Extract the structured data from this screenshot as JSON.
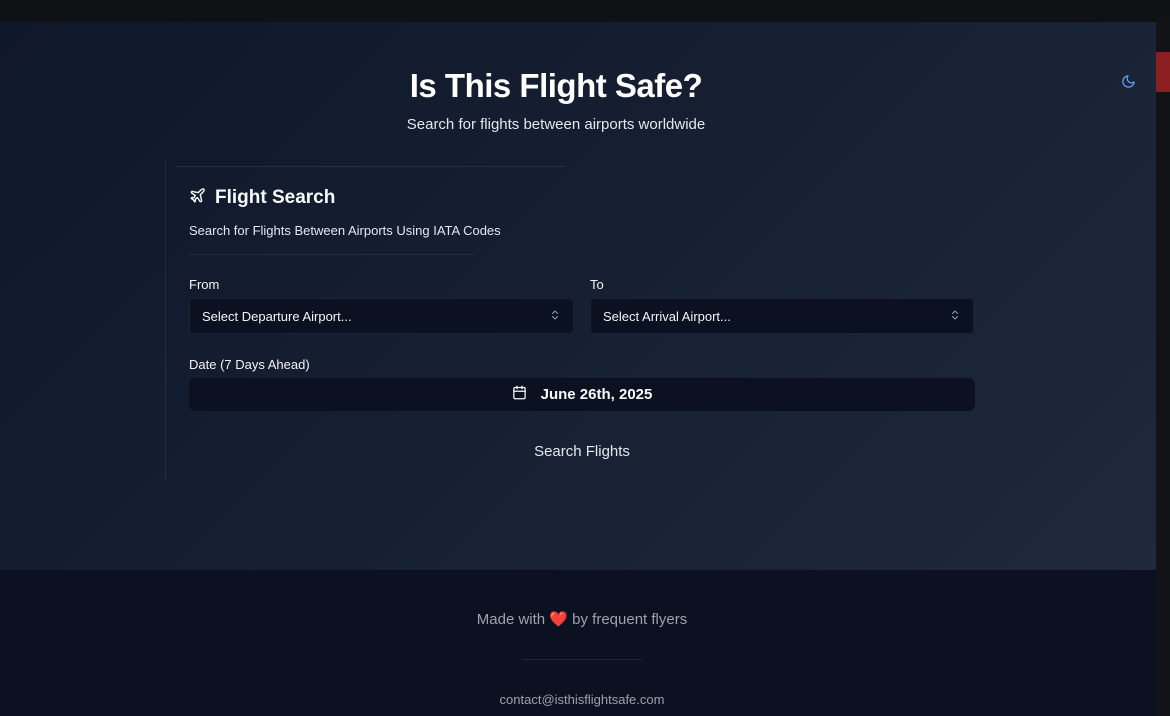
{
  "header": {
    "title": "Is This Flight Safe?",
    "subtitle": "Search for flights between airports worldwide",
    "theme_icon": "moon-icon",
    "accent_color": "#60a5fa"
  },
  "card": {
    "icon": "plane-icon",
    "title": "Flight Search",
    "description": "Search for Flights Between Airports Using IATA Codes"
  },
  "form": {
    "from_label": "From",
    "from_placeholder": "Select Departure Airport...",
    "to_label": "To",
    "to_placeholder": "Select Arrival Airport...",
    "date_label": "Date (7 Days Ahead)",
    "date_value": "June 26th, 2025",
    "search_label": "Search Flights"
  },
  "footer": {
    "made_with_prefix": "Made with",
    "heart": "❤️",
    "made_with_suffix": "by frequent flyers",
    "contact": "contact@isthisflightsafe.com"
  }
}
